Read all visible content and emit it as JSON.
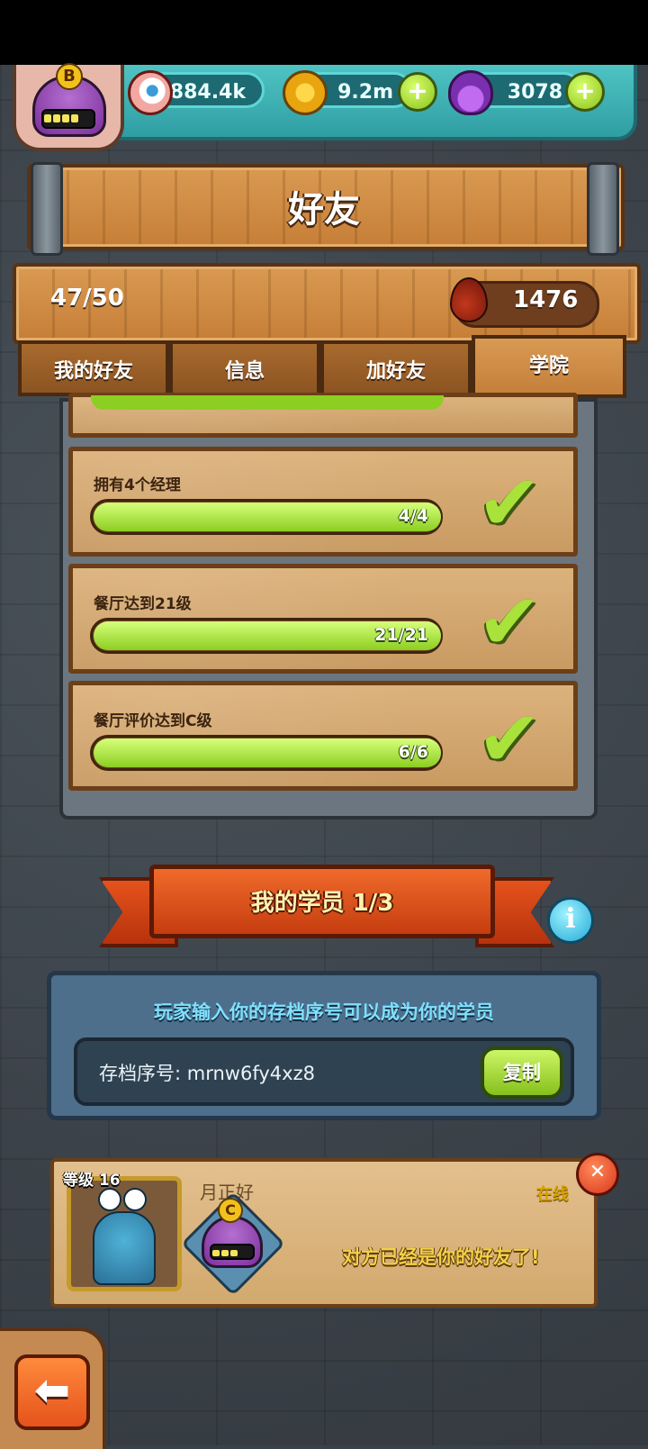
{
  "resources": {
    "eyes": "884.4k",
    "coins": "9.2m",
    "potion": "3078"
  },
  "avatar": {
    "rank": "B"
  },
  "header": {
    "title": "好友"
  },
  "stats": {
    "friend_count": "47/50",
    "blood": "1476"
  },
  "tabs": [
    {
      "label": "我的好友"
    },
    {
      "label": "信息"
    },
    {
      "label": "加好友"
    },
    {
      "label": "学院",
      "active": true
    }
  ],
  "quests": [
    {
      "title": "拥有4个经理",
      "progress_text": "4/4",
      "progress": 1.0,
      "completed": true
    },
    {
      "title": "餐厅达到21级",
      "progress_text": "21/21",
      "progress": 1.0,
      "completed": true
    },
    {
      "title": "餐厅评价达到C级",
      "progress_text": "6/6",
      "progress": 1.0,
      "completed": true
    }
  ],
  "students": {
    "banner_prefix": "我的学员",
    "banner_count": "1/3",
    "hint": "玩家输入你的存档序号可以成为你的学员",
    "code_label": "存档序号:",
    "code_value": "mrnw6fy4xz8",
    "copy_label": "复制"
  },
  "student_card": {
    "level_label": "等级",
    "level_value": "16",
    "name": "月正好",
    "status": "在线",
    "rank": "C",
    "message": "对方已经是你的好友了!"
  },
  "colors": {
    "accent_green": "#8dce22",
    "wood": "#c67e37",
    "teal": "#2f9ea3",
    "ribbon": "#e5531c"
  }
}
